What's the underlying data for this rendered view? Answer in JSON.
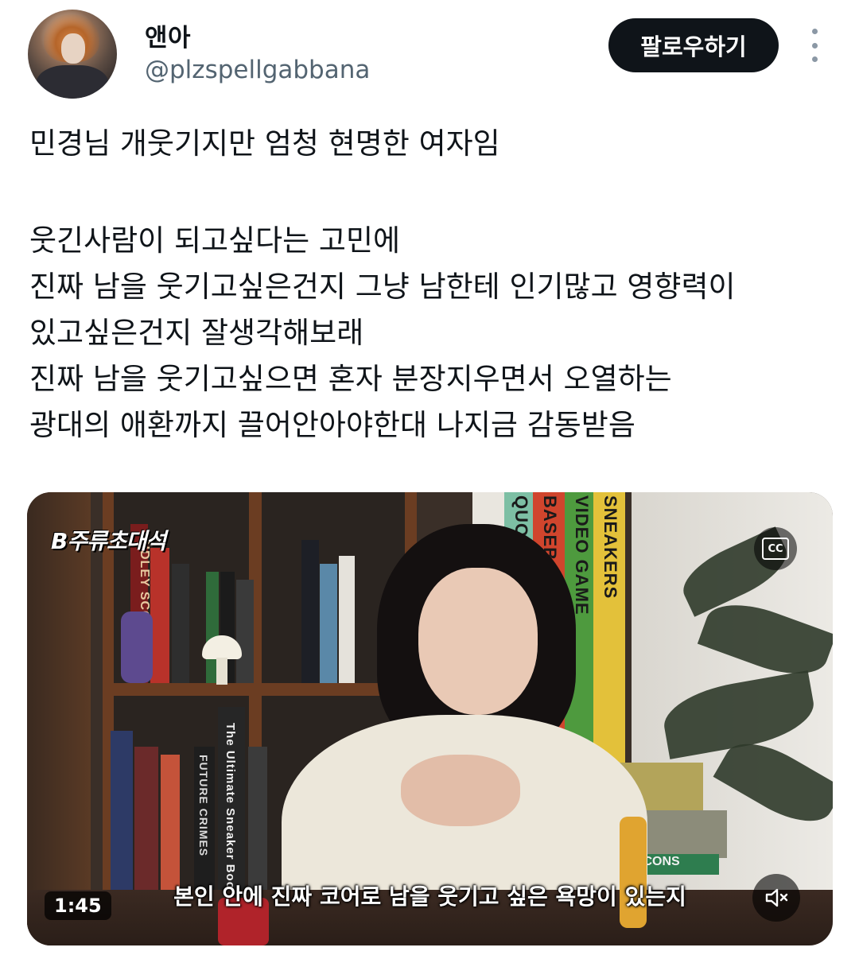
{
  "author": {
    "display_name": "앤아",
    "handle": "@plzspellgabbana"
  },
  "header": {
    "follow_label": "팔로우하기",
    "more_icon": "more-vertical-icon"
  },
  "tweet": {
    "lines": [
      "민경님 개웃기지만 엄청 현명한 여자임",
      "",
      "웃긴사람이 되고싶다는 고민에",
      "진짜 남을 웃기고싶은건지 그냥 남한테 인기많고 영향력이",
      "있고싶은건지 잘생각해보래",
      "진짜 남을 웃기고싶으면 혼자 분장지우면서 오열하는",
      "광대의 애환까지 끌어안아야한대  나지금 감동받음"
    ]
  },
  "video": {
    "channel_logo": "B주류초대석",
    "book_spines": [
      "RIDLEY SCOTT",
      "QUO",
      "BASEBALL",
      "VIDEO GAME",
      "SNEAKERS",
      "FUTURE CRIMES",
      "The Ultimate Sneaker Book",
      "ICONS"
    ],
    "subtitle": "본인 안에 진짜 코어로 남을 웃기고 싶은 욕망이 있는지",
    "duration": "1:45",
    "cc_label": "CC",
    "cc_icon": "closed-captions-icon",
    "mute_icon": "volume-muted-icon"
  }
}
